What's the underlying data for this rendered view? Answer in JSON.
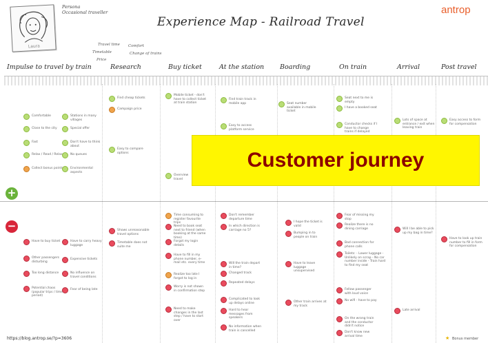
{
  "persona": {
    "role_line1": "Persona",
    "role_line2": "Occasional traveller",
    "name": "Laura"
  },
  "title": "Experience Map - Railroad Travel",
  "logo": "antrop",
  "notes": [
    "Travel time",
    "Comfort",
    "Timetable",
    "Change of trains",
    "Price"
  ],
  "phases": [
    "Impulse to travel by train",
    "Research",
    "Buy ticket",
    "At the station",
    "Boarding",
    "On train",
    "Arrival",
    "Post travel"
  ],
  "positive": {
    "impulse": [
      "Comfortable",
      "Close to the city",
      "Fast",
      "Relax / Read / Relax",
      "Collect bonus points",
      "Stations in many villages",
      "Special offer",
      "Don't have to think about",
      "No queues",
      "Environmental aspects"
    ],
    "research": [
      "Find cheap tickets",
      "Campaign price",
      "Easy to compare options"
    ],
    "buy": [
      "Mobile ticket - don't have to collect ticket at train station",
      "Overview travel"
    ],
    "station": [
      "Find train track in mobile app",
      "Easy to access platform service"
    ],
    "boarding": [
      "Seat number available in mobile ticket"
    ],
    "train": [
      "Seat next to me is empty",
      "I have a booked seat",
      "Conductor checks if I have to change trains if delayed"
    ],
    "arrival": [
      "Lots of space at entrance / exit when leaving train"
    ],
    "post": [
      "Easy access to form for compensation"
    ]
  },
  "negative": {
    "impulse": [
      "Have to buy ticket",
      "Have to carry heavy luggage",
      "Other passengers disturbing",
      "Expensive tickets",
      "Too long distance",
      "No influence on travel conditions",
      "Potential chaos (popular trips / time period)",
      "Fear of being late"
    ],
    "research": [
      "Shows unreasonable travel options",
      "Timetable does not suite me"
    ],
    "buy": [
      "Time consuming to register favourite trips",
      "Need to book seat next to friend (when booking at the same time)",
      "Forgot my login details",
      "Have to fill in my phone number, e-mail etc. every time",
      "Realize too late I forgot to log in",
      "Worry is not shown in confirmation step",
      "Need to make changes in the last step / have to start over"
    ],
    "station": [
      "Don't remember departure time",
      "In which direction is carriage no 5?",
      "Will the train depart in time?",
      "Changed track",
      "Repeated delays",
      "Complicated to look up delays online",
      "Hard to hear messages from speakers",
      "No information when train is cancelled"
    ],
    "boarding": [
      "I hope the ticket is valid",
      "Bumping in to people on train",
      "Have to leave luggage unsupervised",
      "Other train arrives at my track"
    ],
    "train": [
      "Fear of missing my stop",
      "Realize there is no dining carriage",
      "Bad connection for phone calls",
      "Toilets: - Lower luggage - Unlikely on scrap - No car number inside - Train hard to find my seat",
      "Fellow passenger with loud voice",
      "No wifi - have to pay",
      "On the wrong train and the conductor didn't notice",
      "Don't know new arrival time"
    ],
    "arrival": [
      "Will I be able to pick up my bag in time?",
      "Late arrival"
    ],
    "post": [
      "Have to look up train number to fill in form for compensation"
    ]
  },
  "overlay": "Customer journey",
  "url": "https://blog.antrop.se/?p=3606",
  "brand": "Bonus member",
  "colors": {
    "positive": "#6bb33b",
    "negative": "#d8263a",
    "overlay_bg": "#fff600",
    "overlay_text": "#8b0000",
    "logo": "#e85e2b"
  }
}
